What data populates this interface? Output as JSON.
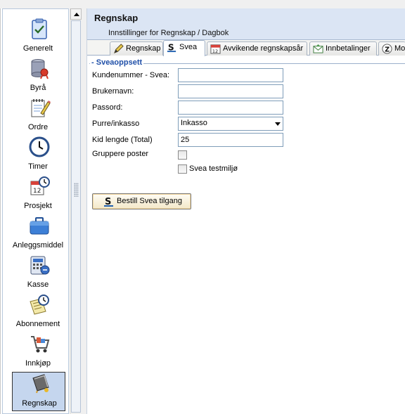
{
  "sidebar": {
    "items": [
      {
        "label": "Generelt",
        "icon": "checklist-icon"
      },
      {
        "label": "Byrå",
        "icon": "database-award-icon"
      },
      {
        "label": "Ordre",
        "icon": "notepad-pencil-icon"
      },
      {
        "label": "Timer",
        "icon": "clock-icon"
      },
      {
        "label": "Prosjekt",
        "icon": "calendar-clock-icon"
      },
      {
        "label": "Anleggsmiddel",
        "icon": "briefcase-icon"
      },
      {
        "label": "Kasse",
        "icon": "calculator-icon"
      },
      {
        "label": "Abonnement",
        "icon": "note-clock-icon"
      },
      {
        "label": "Innkjøp",
        "icon": "shopping-cart-icon"
      },
      {
        "label": "Regnskap",
        "icon": "ledger-book-icon",
        "active": true
      }
    ]
  },
  "header": {
    "title": "Regnskap",
    "subtitle": "Innstillinger for Regnskap / Dagbok"
  },
  "tabs": [
    {
      "label": "Regnskap",
      "icon": "pencil-icon"
    },
    {
      "label": "Svea",
      "icon": "svea-logo-icon",
      "active": true
    },
    {
      "label": "Avvikende regnskapsår",
      "icon": "calendar-icon"
    },
    {
      "label": "Innbetalinger",
      "icon": "envelope-icon"
    },
    {
      "label": "Mo",
      "icon": "z-icon"
    }
  ],
  "form": {
    "section_title": "Sveaoppsett",
    "fields": [
      {
        "label": "Kundenummer - Svea:",
        "value": ""
      },
      {
        "label": "Brukernavn:",
        "value": ""
      },
      {
        "label": "Passord:",
        "value": ""
      },
      {
        "label": "Purre/inkasso",
        "value": "Inkasso"
      },
      {
        "label": "Kid lengde (Total)",
        "value": "25"
      }
    ],
    "group_label": "Gruppere poster",
    "testmode_label": "Svea testmiljø",
    "order_button": "Bestill Svea tilgang"
  },
  "colors": {
    "header_bg": "#dbe5f4",
    "section_title": "#1f4fa8",
    "active_item_bg": "#c5d6ee",
    "button_bg": "#f3e8c8"
  }
}
